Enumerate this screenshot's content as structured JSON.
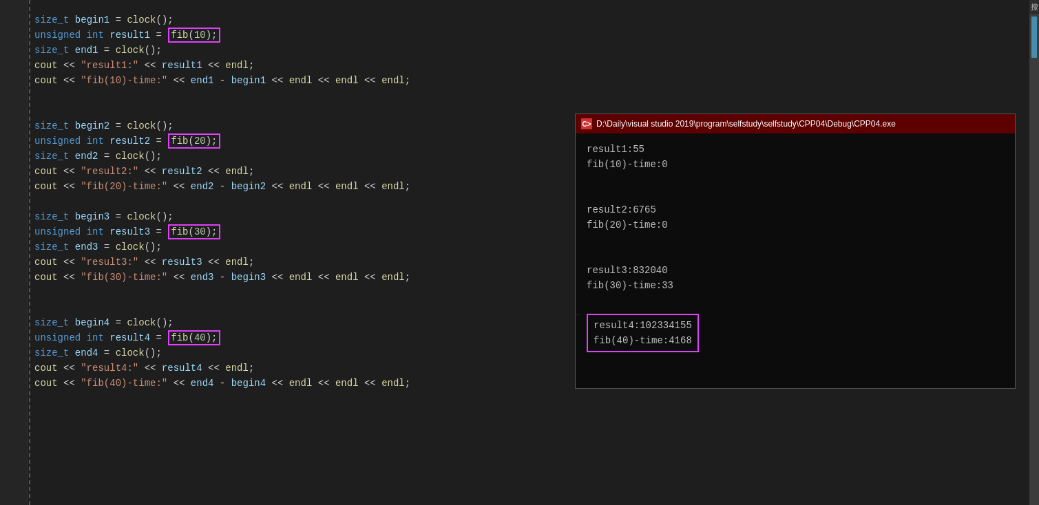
{
  "editor": {
    "background": "#1e1e1e",
    "lines": [
      {
        "id": 1,
        "tokens": [
          {
            "t": "size_t",
            "c": "kw"
          },
          {
            "t": " begin1 ",
            "c": "plain"
          },
          {
            "t": "=",
            "c": "op"
          },
          {
            "t": " clock",
            "c": "fn"
          },
          {
            "t": "();",
            "c": "plain"
          }
        ],
        "highlight": null
      },
      {
        "id": 2,
        "tokens": [
          {
            "t": "unsigned ",
            "c": "kw"
          },
          {
            "t": "int ",
            "c": "kw"
          },
          {
            "t": "result1 ",
            "c": "var"
          },
          {
            "t": "=",
            "c": "op"
          }
        ],
        "highlight": {
          "text": "fib(10);",
          "suffix": ""
        }
      },
      {
        "id": 3,
        "tokens": [
          {
            "t": "size_t ",
            "c": "kw"
          },
          {
            "t": "end1 ",
            "c": "var"
          },
          {
            "t": "= ",
            "c": "op"
          },
          {
            "t": "clock",
            "c": "fn"
          },
          {
            "t": "();",
            "c": "plain"
          }
        ],
        "highlight": null
      },
      {
        "id": 4,
        "tokens": [
          {
            "t": "cout ",
            "c": "fn"
          },
          {
            "t": "<< ",
            "c": "op"
          },
          {
            "t": "\"result1:\" ",
            "c": "str"
          },
          {
            "t": "<< ",
            "c": "op"
          },
          {
            "t": "result1 ",
            "c": "var"
          },
          {
            "t": "<< ",
            "c": "op"
          },
          {
            "t": "endl",
            "c": "fn"
          },
          {
            "t": ";",
            "c": "plain"
          }
        ],
        "highlight": null
      },
      {
        "id": 5,
        "tokens": [
          {
            "t": "cout ",
            "c": "fn"
          },
          {
            "t": "<< ",
            "c": "op"
          },
          {
            "t": "\"fib(10)-time:\" ",
            "c": "str"
          },
          {
            "t": "<< ",
            "c": "op"
          },
          {
            "t": "end1 ",
            "c": "var"
          },
          {
            "t": "- ",
            "c": "op"
          },
          {
            "t": "begin1 ",
            "c": "var"
          },
          {
            "t": "<< ",
            "c": "op"
          },
          {
            "t": "endl ",
            "c": "fn"
          },
          {
            "t": "<< ",
            "c": "op"
          },
          {
            "t": "endl ",
            "c": "fn"
          },
          {
            "t": "<< ",
            "c": "op"
          },
          {
            "t": "endl",
            "c": "fn"
          },
          {
            "t": ";",
            "c": "plain"
          }
        ],
        "highlight": null
      },
      {
        "id": 6,
        "type": "empty"
      },
      {
        "id": 7,
        "type": "empty"
      },
      {
        "id": 8,
        "tokens": [
          {
            "t": "size_t ",
            "c": "kw"
          },
          {
            "t": "begin2 ",
            "c": "plain"
          },
          {
            "t": "= ",
            "c": "op"
          },
          {
            "t": "clock",
            "c": "fn"
          },
          {
            "t": "();",
            "c": "plain"
          }
        ],
        "highlight": null
      },
      {
        "id": 9,
        "tokens": [
          {
            "t": "unsigned ",
            "c": "kw"
          },
          {
            "t": "int ",
            "c": "kw"
          },
          {
            "t": "result2 ",
            "c": "var"
          },
          {
            "t": "=",
            "c": "op"
          }
        ],
        "highlight": {
          "text": "fib(20);",
          "suffix": ""
        }
      },
      {
        "id": 10,
        "tokens": [
          {
            "t": "size_t ",
            "c": "kw"
          },
          {
            "t": "end2 ",
            "c": "var"
          },
          {
            "t": "= ",
            "c": "op"
          },
          {
            "t": "clock",
            "c": "fn"
          },
          {
            "t": "();",
            "c": "plain"
          }
        ],
        "highlight": null
      },
      {
        "id": 11,
        "tokens": [
          {
            "t": "cout ",
            "c": "fn"
          },
          {
            "t": "<< ",
            "c": "op"
          },
          {
            "t": "\"result2:\" ",
            "c": "str"
          },
          {
            "t": "<< ",
            "c": "op"
          },
          {
            "t": "result2 ",
            "c": "var"
          },
          {
            "t": "<< ",
            "c": "op"
          },
          {
            "t": "endl",
            "c": "fn"
          },
          {
            "t": ";",
            "c": "plain"
          }
        ],
        "highlight": null
      },
      {
        "id": 12,
        "tokens": [
          {
            "t": "cout ",
            "c": "fn"
          },
          {
            "t": "<< ",
            "c": "op"
          },
          {
            "t": "\"fib(20)-time:\" ",
            "c": "str"
          },
          {
            "t": "<< ",
            "c": "op"
          },
          {
            "t": "end2 ",
            "c": "var"
          },
          {
            "t": "- ",
            "c": "op"
          },
          {
            "t": "begin2 ",
            "c": "var"
          },
          {
            "t": "<< ",
            "c": "op"
          },
          {
            "t": "endl ",
            "c": "fn"
          },
          {
            "t": "<< ",
            "c": "op"
          },
          {
            "t": "endl ",
            "c": "fn"
          },
          {
            "t": "<< ",
            "c": "op"
          },
          {
            "t": "endl",
            "c": "fn"
          },
          {
            "t": ";",
            "c": "plain"
          }
        ],
        "highlight": null
      },
      {
        "id": 13,
        "type": "empty"
      },
      {
        "id": 14,
        "tokens": [
          {
            "t": "size_t ",
            "c": "kw"
          },
          {
            "t": "begin3 ",
            "c": "plain"
          },
          {
            "t": "= ",
            "c": "op"
          },
          {
            "t": "clock",
            "c": "fn"
          },
          {
            "t": "();",
            "c": "plain"
          }
        ],
        "highlight": null
      },
      {
        "id": 15,
        "tokens": [
          {
            "t": "unsigned ",
            "c": "kw"
          },
          {
            "t": "int ",
            "c": "kw"
          },
          {
            "t": "result3 ",
            "c": "var"
          },
          {
            "t": "=",
            "c": "op"
          }
        ],
        "highlight": {
          "text": "fib(30);",
          "suffix": ""
        }
      },
      {
        "id": 16,
        "tokens": [
          {
            "t": "size_t ",
            "c": "kw"
          },
          {
            "t": "end3 ",
            "c": "var"
          },
          {
            "t": "= ",
            "c": "op"
          },
          {
            "t": "clock",
            "c": "fn"
          },
          {
            "t": "();",
            "c": "plain"
          }
        ],
        "highlight": null
      },
      {
        "id": 17,
        "tokens": [
          {
            "t": "cout ",
            "c": "fn"
          },
          {
            "t": "<< ",
            "c": "op"
          },
          {
            "t": "\"result3:\" ",
            "c": "str"
          },
          {
            "t": "<< ",
            "c": "op"
          },
          {
            "t": "result3 ",
            "c": "var"
          },
          {
            "t": "<< ",
            "c": "op"
          },
          {
            "t": "endl",
            "c": "fn"
          },
          {
            "t": ";",
            "c": "plain"
          }
        ],
        "highlight": null
      },
      {
        "id": 18,
        "tokens": [
          {
            "t": "cout ",
            "c": "fn"
          },
          {
            "t": "<< ",
            "c": "op"
          },
          {
            "t": "\"fib(30)-time:\" ",
            "c": "str"
          },
          {
            "t": "<< ",
            "c": "op"
          },
          {
            "t": "end3 ",
            "c": "var"
          },
          {
            "t": "- ",
            "c": "op"
          },
          {
            "t": "begin3 ",
            "c": "var"
          },
          {
            "t": "<< ",
            "c": "op"
          },
          {
            "t": "endl ",
            "c": "fn"
          },
          {
            "t": "<< ",
            "c": "op"
          },
          {
            "t": "endl ",
            "c": "fn"
          },
          {
            "t": "<< ",
            "c": "op"
          },
          {
            "t": "endl",
            "c": "fn"
          },
          {
            "t": ";",
            "c": "plain"
          }
        ],
        "highlight": null
      },
      {
        "id": 19,
        "type": "empty"
      },
      {
        "id": 20,
        "type": "empty"
      },
      {
        "id": 21,
        "tokens": [
          {
            "t": "size_t ",
            "c": "kw"
          },
          {
            "t": "begin4 ",
            "c": "plain"
          },
          {
            "t": "= ",
            "c": "op"
          },
          {
            "t": "clock",
            "c": "fn"
          },
          {
            "t": "();",
            "c": "plain"
          }
        ],
        "highlight": null
      },
      {
        "id": 22,
        "tokens": [
          {
            "t": "unsigned ",
            "c": "kw"
          },
          {
            "t": "int ",
            "c": "kw"
          },
          {
            "t": "result4 ",
            "c": "var"
          },
          {
            "t": "=",
            "c": "op"
          }
        ],
        "highlight": {
          "text": "fib(40);",
          "suffix": ""
        }
      },
      {
        "id": 23,
        "tokens": [
          {
            "t": "size_t ",
            "c": "kw"
          },
          {
            "t": "end4 ",
            "c": "var"
          },
          {
            "t": "= ",
            "c": "op"
          },
          {
            "t": "clock",
            "c": "fn"
          },
          {
            "t": "();",
            "c": "plain"
          }
        ],
        "highlight": null
      },
      {
        "id": 24,
        "tokens": [
          {
            "t": "cout ",
            "c": "fn"
          },
          {
            "t": "<< ",
            "c": "op"
          },
          {
            "t": "\"result4:\" ",
            "c": "str"
          },
          {
            "t": "<< ",
            "c": "op"
          },
          {
            "t": "result4 ",
            "c": "var"
          },
          {
            "t": "<< ",
            "c": "op"
          },
          {
            "t": "endl",
            "c": "fn"
          },
          {
            "t": ";",
            "c": "plain"
          }
        ],
        "highlight": null
      },
      {
        "id": 25,
        "tokens": [
          {
            "t": "cout ",
            "c": "fn"
          },
          {
            "t": "<< ",
            "c": "op"
          },
          {
            "t": "\"fib(40)-time:\" ",
            "c": "str"
          },
          {
            "t": "<< ",
            "c": "op"
          },
          {
            "t": "end4 ",
            "c": "var"
          },
          {
            "t": "- ",
            "c": "op"
          },
          {
            "t": "begin4 ",
            "c": "var"
          },
          {
            "t": "<< ",
            "c": "op"
          },
          {
            "t": "endl ",
            "c": "fn"
          },
          {
            "t": "<< ",
            "c": "op"
          },
          {
            "t": "endl ",
            "c": "fn"
          },
          {
            "t": "<< ",
            "c": "op"
          },
          {
            "t": "endl",
            "c": "fn"
          },
          {
            "t": ";",
            "c": "plain"
          }
        ],
        "highlight": null
      }
    ]
  },
  "terminal": {
    "title": "D:\\Daily\\visual studio 2019\\program\\selfstudy\\selfstudy\\CPP04\\Debug\\CPP04.exe",
    "lines": [
      "result1:55",
      "fib(10)-time:0",
      "",
      "",
      "result2:6765",
      "fib(20)-time:0",
      "",
      "",
      "result3:832040",
      "fib(30)-time:33",
      ""
    ],
    "highlighted": [
      "result4:102334155",
      "fib(40)-time:4168"
    ]
  },
  "scrollbar": {
    "label": "搜"
  }
}
